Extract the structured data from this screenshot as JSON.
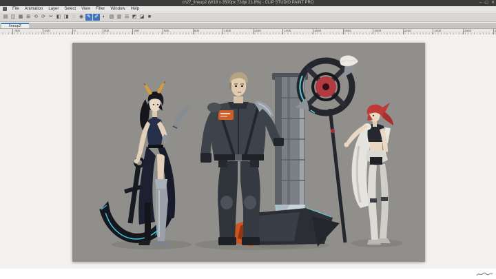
{
  "window": {
    "title": "ch27_lineup2 (W18 x 3500px 72dpi 21.8%) - CLIP STUDIO PAINT PRO",
    "controls": [
      {
        "name": "minimize-button",
        "glyph": "–"
      },
      {
        "name": "maximize-button",
        "glyph": "▢"
      },
      {
        "name": "close-button",
        "glyph": "✕"
      }
    ]
  },
  "menu": {
    "items": [
      "File",
      "Animation",
      "Layer",
      "Select",
      "View",
      "Filter",
      "Window",
      "Help"
    ]
  },
  "toolbar": {
    "icons": [
      {
        "name": "new-document",
        "glyph": "▤",
        "active": false
      },
      {
        "name": "open-file",
        "glyph": "◫",
        "active": false
      },
      {
        "name": "save-file",
        "glyph": "▦",
        "active": false
      },
      {
        "name": "export",
        "glyph": "⊞",
        "active": false
      },
      {
        "name": "undo",
        "glyph": "⟲",
        "active": false
      },
      {
        "name": "redo",
        "glyph": "⟳",
        "active": false
      },
      {
        "name": "cut",
        "glyph": "✂",
        "active": false
      },
      {
        "name": "copy",
        "glyph": "◧",
        "active": false
      },
      {
        "name": "paste",
        "glyph": "◨",
        "active": false
      },
      {
        "name": "deselect",
        "glyph": "◌",
        "active": false
      },
      {
        "name": "fill-tool",
        "glyph": "◉",
        "active": false
      },
      {
        "name": "pen-tool",
        "glyph": "✎",
        "active": true
      },
      {
        "name": "brush-tool",
        "glyph": "✐",
        "active": true
      },
      {
        "name": "tone-tool",
        "glyph": "◐",
        "active": false
      },
      {
        "name": "layer-panel",
        "glyph": "▧",
        "active": false
      },
      {
        "name": "grid-toggle",
        "glyph": "▥",
        "active": false
      },
      {
        "name": "ruler-toggle",
        "glyph": "⊟",
        "active": false
      },
      {
        "name": "snap-toggle",
        "glyph": "◩",
        "active": false
      },
      {
        "name": "material-panel",
        "glyph": "◪",
        "active": false
      },
      {
        "name": "settings",
        "glyph": "■",
        "active": false
      }
    ]
  },
  "tabs": {
    "active_label": "lineup2"
  },
  "ruler": {
    "labels": [
      "-400",
      "-200",
      "0",
      "200",
      "400",
      "600",
      "800",
      "1000",
      "1200",
      "1400",
      "1600",
      "1800",
      "2000",
      "2200",
      "2400",
      "2600",
      "2800"
    ]
  },
  "canvas": {
    "zoom_percent": "21.8%"
  },
  "colors": {
    "canvas_background": "#908f8b",
    "viewport_background": "#f2f1ee",
    "titlebar": "#3b3b3b",
    "accent_blue": "#3f76bb",
    "glow_cyan": "#5fe3f5",
    "orange_accent": "#cf5520",
    "red_accent": "#b23a40",
    "horn_yellow": "#d89b3c"
  }
}
